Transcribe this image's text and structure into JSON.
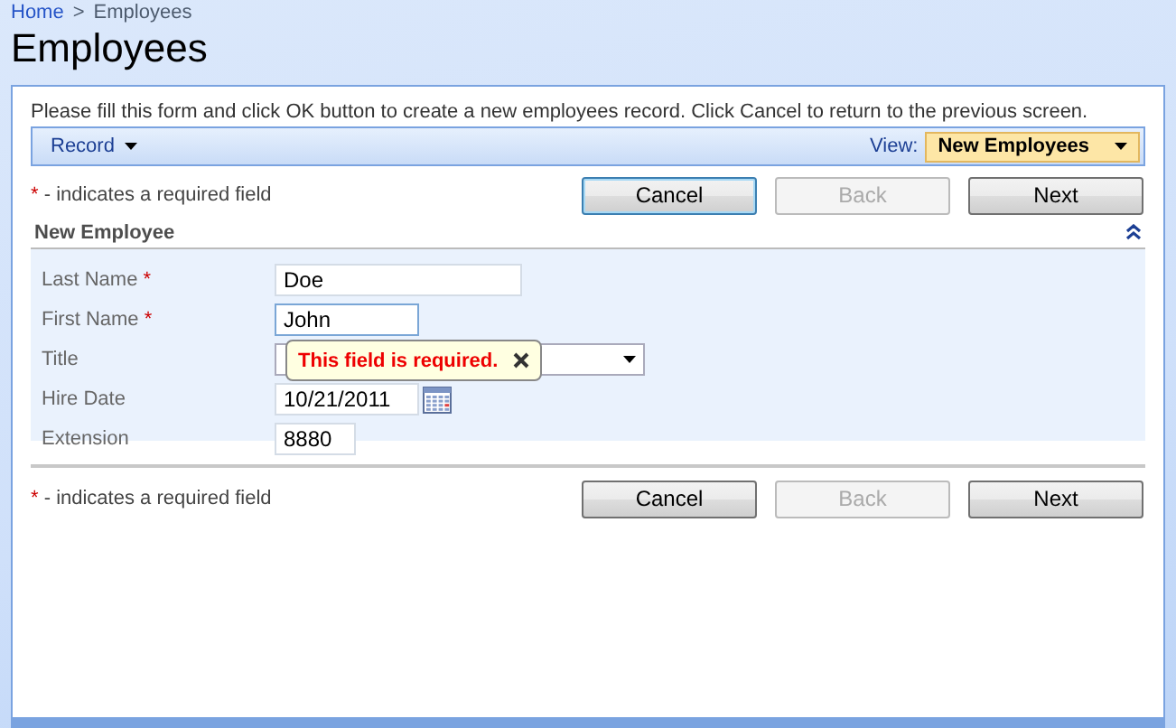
{
  "breadcrumb": [
    {
      "label": "Home",
      "link": true
    },
    {
      "label": ">",
      "link": false
    },
    {
      "label": "Employees",
      "link": false
    }
  ],
  "page_title": "Employees",
  "instructions": "Please fill this form and click OK button to create a new employees record. Click Cancel to return to the previous screen.",
  "toolbar": {
    "record_menu": "Record",
    "view_label": "View:",
    "view_value": "New Employees"
  },
  "top_bar": {
    "required_note": {
      "mark": "*",
      "text": "- indicates a required field"
    },
    "buttons": [
      {
        "label": "Cancel",
        "disabled": false,
        "focused": true
      },
      {
        "label": "Back",
        "disabled": true,
        "focused": false
      },
      {
        "label": "Next",
        "disabled": false,
        "focused": false
      }
    ]
  },
  "section": {
    "title": "New Employee",
    "expanded": true,
    "fields": [
      {
        "kind": "text",
        "label": "Last Name",
        "required_mark": "*",
        "value": "Doe"
      },
      {
        "kind": "text",
        "label": "First Name",
        "required_mark": "*",
        "value": "John",
        "focused": true
      },
      {
        "kind": "select",
        "label": "Title",
        "error": "This field is required."
      },
      {
        "kind": "date",
        "label": "Hire Date",
        "value": "10/21/2011"
      },
      {
        "kind": "text",
        "label": "Extension",
        "value": "8880"
      }
    ]
  },
  "bottom_bar": {
    "required_note": {
      "mark": "*",
      "text": "- indicates a required field"
    },
    "buttons": [
      {
        "label": "Cancel",
        "disabled": false,
        "focused": false
      },
      {
        "label": "Back",
        "disabled": true,
        "focused": false
      },
      {
        "label": "Next",
        "disabled": false,
        "focused": false
      }
    ]
  }
}
